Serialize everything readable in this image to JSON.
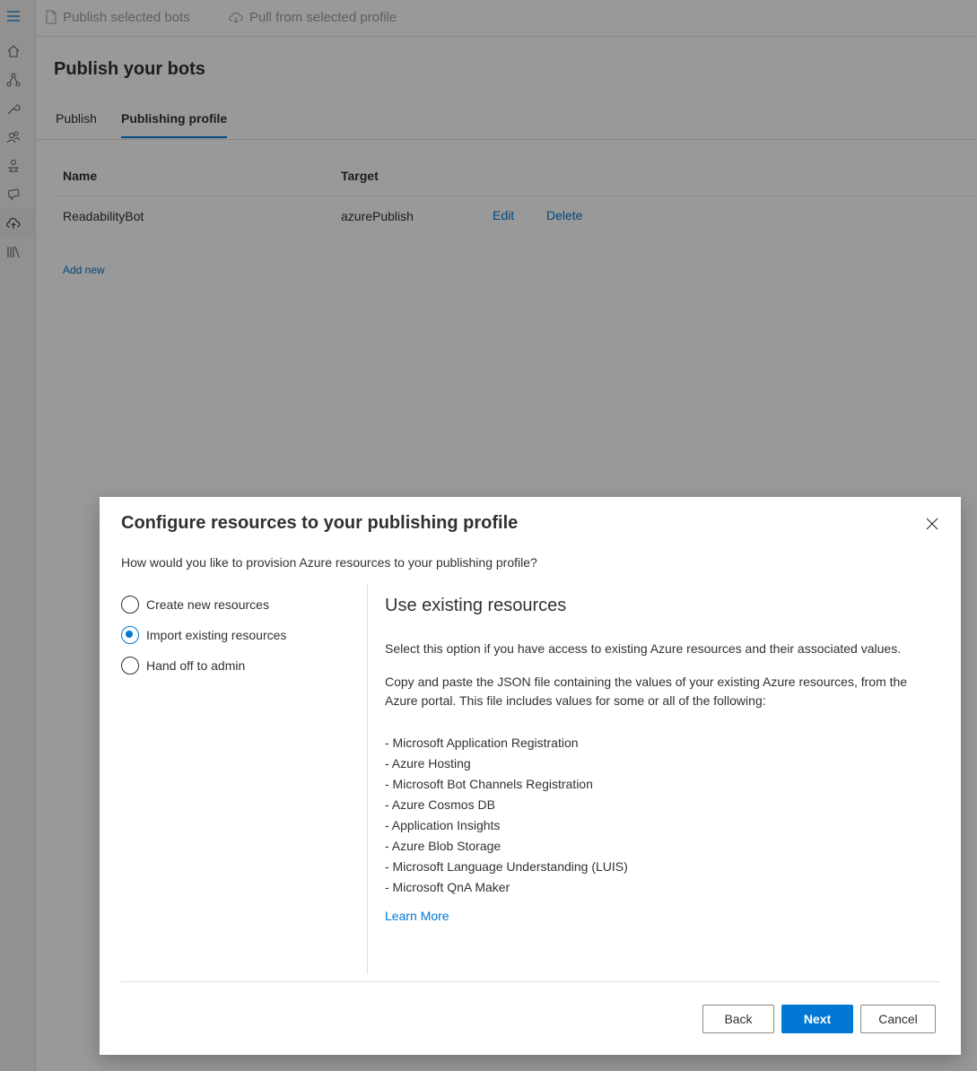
{
  "toolbar": {
    "publish_selected_label": "Publish selected bots",
    "pull_label": "Pull from selected profile"
  },
  "page": {
    "title": "Publish your bots",
    "tabs": [
      {
        "label": "Publish"
      },
      {
        "label": "Publishing profile"
      }
    ]
  },
  "table": {
    "columns": [
      "Name",
      "Target"
    ],
    "rows": [
      {
        "name": "ReadabilityBot",
        "target": "azurePublish",
        "edit": "Edit",
        "delete": "Delete"
      }
    ],
    "add_new": "Add new"
  },
  "dialog": {
    "title": "Configure resources to your publishing profile",
    "subtitle": "How would you like to provision Azure resources to your publishing profile?",
    "options": [
      {
        "label": "Create new resources",
        "checked": false
      },
      {
        "label": "Import existing resources",
        "checked": true
      },
      {
        "label": "Hand off to admin",
        "checked": false
      }
    ],
    "panel": {
      "title": "Use existing resources",
      "intro": "Select this option if you have access to existing Azure resources and their associated values.",
      "description": "Copy and paste the JSON file containing the values of your existing Azure resources, from the Azure portal. This file includes values for some or all of the following:",
      "resources": [
        "- Microsoft Application Registration",
        "- Azure Hosting",
        "- Microsoft Bot Channels Registration",
        "- Azure Cosmos DB",
        "- Application Insights",
        "- Azure Blob Storage",
        "- Microsoft Language Understanding (LUIS)",
        "- Microsoft QnA Maker"
      ],
      "learn_more": "Learn More"
    },
    "buttons": {
      "back": "Back",
      "next": "Next",
      "cancel": "Cancel"
    }
  },
  "colors": {
    "accent": "#0078d4",
    "overlay": "rgba(0,0,0,0.4)"
  },
  "icons": {
    "rail": [
      "hamburger-icon",
      "home-icon",
      "design-icon",
      "configure-icon",
      "users-icon",
      "bot-icon",
      "chat-icon",
      "cloud-upload-icon",
      "library-icon"
    ]
  }
}
